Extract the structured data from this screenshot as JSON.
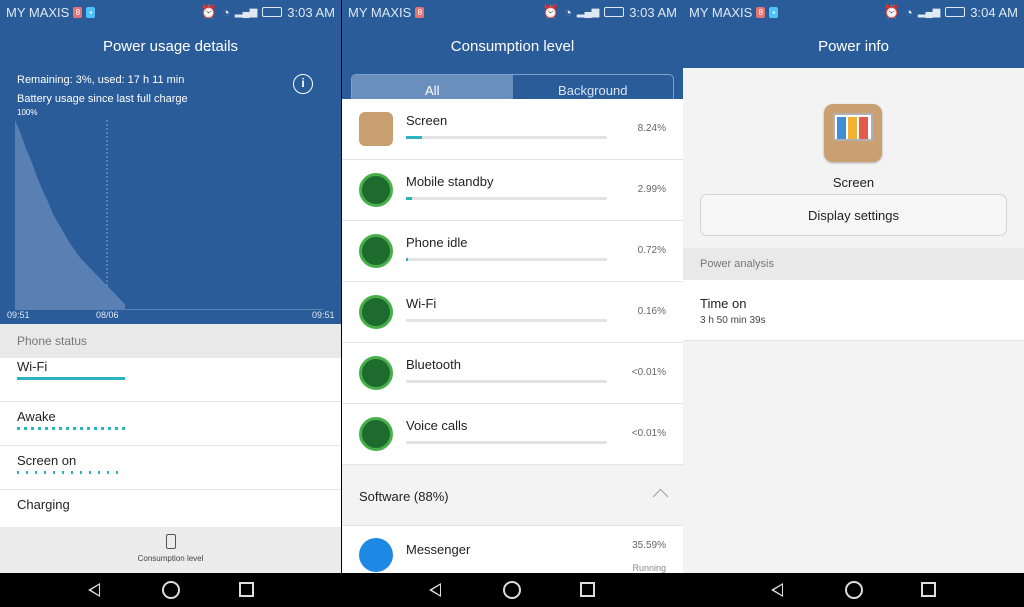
{
  "status_bars": [
    {
      "carrier": "MY MAXIS",
      "time": "3:03 AM",
      "net": "4G"
    },
    {
      "carrier": "MY MAXIS",
      "time": "3:03 AM",
      "net": "4G"
    },
    {
      "carrier": "MY MAXIS",
      "time": "3:04 AM",
      "net": "4G"
    }
  ],
  "panel1": {
    "title": "Power usage details",
    "remaining": "Remaining: 3%, used: 17 h 11 min",
    "battery_label": "Battery usage since last full charge",
    "y_top": "100%",
    "x_start": "09:51",
    "x_mid": "08/06",
    "x_end": "09:51",
    "section": "Phone status",
    "rows": [
      {
        "label": "Wi-Fi"
      },
      {
        "label": "Awake"
      },
      {
        "label": "Screen on"
      },
      {
        "label": "Charging"
      }
    ],
    "bottom_action": "Consumption level"
  },
  "chart_data": {
    "type": "area",
    "title": "Battery usage since last full charge",
    "x_ticks": [
      "09:51",
      "08/06",
      "09:51"
    ],
    "y_tick": "100%",
    "description_series": [
      {
        "values": [
          100,
          93,
          85,
          78,
          70,
          63,
          57,
          50,
          45,
          40,
          35,
          31,
          27,
          24,
          21,
          18,
          15,
          12,
          9,
          6,
          3
        ]
      }
    ]
  },
  "panel2": {
    "title": "Consumption level",
    "tabs": [
      "All",
      "Background"
    ],
    "active_tab": "All",
    "apps": [
      {
        "name": "Screen",
        "pct": "8.24%",
        "fill": 0.08
      },
      {
        "name": "Mobile standby",
        "pct": "2.99%",
        "fill": 0.03
      },
      {
        "name": "Phone idle",
        "pct": "0.72%",
        "fill": 0.01
      },
      {
        "name": "Wi-Fi",
        "pct": "0.16%",
        "fill": 0.0
      },
      {
        "name": "Bluetooth",
        "pct": "<0.01%",
        "fill": 0.0
      },
      {
        "name": "Voice calls",
        "pct": "<0.01%",
        "fill": 0.0
      }
    ],
    "software": "Software (88%)",
    "messenger": {
      "name": "Messenger",
      "pct": "35.59%",
      "status": "Running"
    }
  },
  "panel3": {
    "title": "Power info",
    "app_name": "Screen",
    "button": "Display settings",
    "section": "Power analysis",
    "metric_label": "Time on",
    "metric_value": "3 h 50 min 39s"
  }
}
